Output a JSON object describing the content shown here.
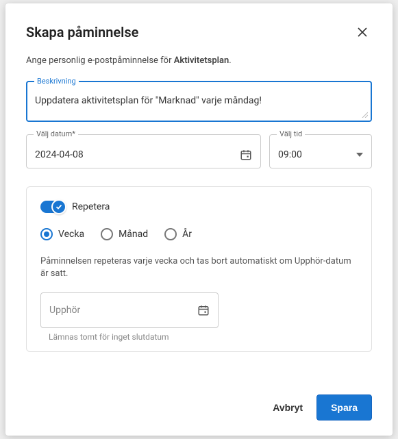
{
  "header": {
    "title": "Skapa påminnelse"
  },
  "subtitle": {
    "prefix": "Ange personlig e-postpåminnelse för ",
    "bold": "Aktivitetsplan",
    "suffix": "."
  },
  "description": {
    "label": "Beskrivning",
    "value": "Uppdatera aktivitetsplan för \"Marknad\" varje måndag!"
  },
  "date": {
    "label": "Välj datum*",
    "value": "2024-04-08"
  },
  "time": {
    "label": "Välj tid",
    "value": "09:00"
  },
  "repeat": {
    "toggle_label": "Repetera",
    "options": {
      "week": "Vecka",
      "month": "Månad",
      "year": "År"
    },
    "helper": "Påminnelsen repeteras varje vecka och tas bort automatiskt om Upphör-datum är satt.",
    "end": {
      "placeholder": "Upphör",
      "hint": "Lämnas tomt för inget slutdatum"
    }
  },
  "footer": {
    "cancel": "Avbryt",
    "save": "Spara"
  }
}
